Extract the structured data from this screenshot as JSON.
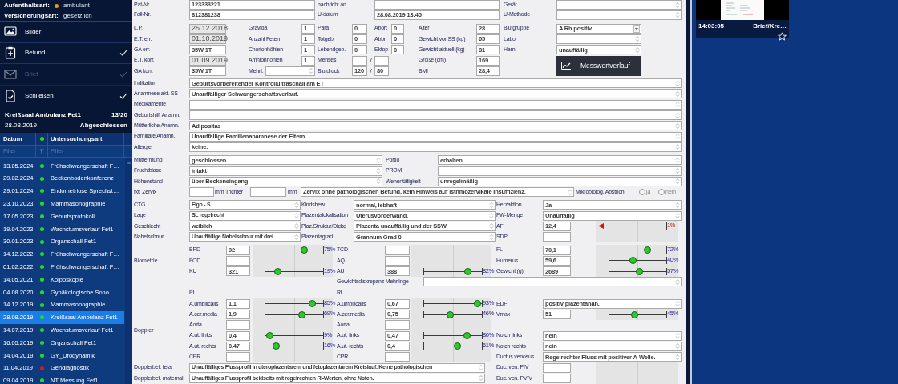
{
  "sidebar": {
    "info": [
      {
        "label": "Aufenthaltsart:",
        "value": "ambulant",
        "color": "#e0a010"
      },
      {
        "label": "Versicherungsart:",
        "value": "gesetzlich"
      }
    ],
    "actions": [
      {
        "kind": "images",
        "label": "Bilder",
        "checked": false,
        "disabled": false
      },
      {
        "kind": "report",
        "label": "Befund",
        "checked": true,
        "disabled": false
      },
      {
        "kind": "letter",
        "label": "Brief",
        "checked": true,
        "disabled": true
      },
      {
        "kind": "close",
        "label": "Schließen",
        "checked": true,
        "disabled": false
      }
    ],
    "exam": {
      "title": "Kreißsaal Ambulanz Fet1",
      "count": "13/20",
      "date": "28.08.2019",
      "status": "Abgeschlossen"
    },
    "table": {
      "columns": [
        "Datum",
        "Untersuchungsart"
      ],
      "filters": [
        "Filter",
        "Filter"
      ],
      "rows": [
        {
          "date": "13.05.2024",
          "type": "Frühschwangerschaft F…",
          "color": "#22dd22",
          "selected": false
        },
        {
          "date": "29.02.2024",
          "type": "Beckenbodenkonferenz",
          "color": "#22dd22",
          "selected": false
        },
        {
          "date": "29.01.2024",
          "type": "Endometriose Sprechst…",
          "color": "#22dd22",
          "selected": false
        },
        {
          "date": "23.10.2023",
          "type": "Mammasonographie",
          "color": "#22dd22",
          "selected": false
        },
        {
          "date": "17.05.2023",
          "type": "Geburtsprotokoll",
          "color": "#22dd22",
          "selected": false
        },
        {
          "date": "19.04.2023",
          "type": "Wachstumsverlauf Fet1",
          "color": "#22dd22",
          "selected": false
        },
        {
          "date": "30.01.2023",
          "type": "Organschall Fet1",
          "color": "#22dd22",
          "selected": false
        },
        {
          "date": "14.12.2022",
          "type": "Frühschwangerschaft F…",
          "color": "#22dd22",
          "selected": false
        },
        {
          "date": "01.02.2022",
          "type": "Frühschwangerschaft F…",
          "color": "#22dd22",
          "selected": false
        },
        {
          "date": "14.05.2021",
          "type": "Kolposkopie",
          "color": "#22dd22",
          "selected": false
        },
        {
          "date": "04.08.2020",
          "type": "Gynäkologische Sono",
          "color": "#22dd22",
          "selected": false
        },
        {
          "date": "14.12.2019",
          "type": "Mammasonographie",
          "color": "#22dd22",
          "selected": false
        },
        {
          "date": "28.08.2019",
          "type": "Kreißsaal Ambulanz Fet1",
          "color": "#22dd22",
          "selected": true
        },
        {
          "date": "14.07.2019",
          "type": "Wachstumsverlauf Fet1",
          "color": "#22dd22",
          "selected": false
        },
        {
          "date": "16.05.2019",
          "type": "Organschall Fet1",
          "color": "#22dd22",
          "selected": false
        },
        {
          "date": "14.04.2019",
          "type": "GY_Urodynamik",
          "color": "#22dd22",
          "selected": false
        },
        {
          "date": "11.04.2019",
          "type": "Gendiagnostik",
          "color": "#ee1111",
          "selected": false
        },
        {
          "date": "09.04.2019",
          "type": "NT Messung Fet1",
          "color": "#22dd22",
          "selected": false
        }
      ]
    }
  },
  "form": {
    "top_rows": [
      [
        {
          "label": "Pat-Nr.",
          "value": "123333221"
        },
        {
          "label": "nachricht.an"
        },
        {
          "label": "Gerät"
        }
      ],
      [
        {
          "label": "Fall-Nr.",
          "value": "812381238"
        },
        {
          "label": "U-datum",
          "value": "28.08.2019 13:45"
        },
        {
          "label": "U-Methode"
        }
      ]
    ],
    "history": [
      {
        "kind": "date",
        "label": "L.P.",
        "value": "25.12.2018"
      },
      {
        "kind": "date",
        "label": "E.T. err.",
        "value": "01.10.2019"
      },
      {
        "kind": "text",
        "label": "GA err.",
        "value": "35W 1T"
      },
      {
        "kind": "date",
        "label": "E.T. korr.",
        "value": "01.09.2019"
      },
      {
        "kind": "text",
        "label": "GA korr.",
        "value": "35W 1T"
      }
    ],
    "counts": [
      {
        "kind": "number",
        "label": "Gravida",
        "value": "1"
      },
      {
        "kind": "number",
        "label": "Anzahl Feten",
        "value": "1"
      },
      {
        "kind": "number",
        "label": "Chorionhöhlen",
        "value": "1"
      },
      {
        "kind": "number",
        "label": "Amnionhöhlen",
        "value": "1"
      },
      {
        "kind": "spin",
        "label": "Mehrl."
      }
    ],
    "births": [
      {
        "kind": "number",
        "label": "Para",
        "value": "0"
      },
      {
        "kind": "number",
        "label": "Totgeb.",
        "value": "0"
      },
      {
        "kind": "number",
        "label": "Lebendgeb.",
        "value": "0"
      },
      {
        "kind": "pair",
        "label": "Menses",
        "separator": "/"
      },
      {
        "kind": "pair",
        "label": "Blutdruck",
        "value": "120",
        "separator": "/",
        "value2": "80"
      }
    ],
    "losses": [
      {
        "label": "Abort",
        "value": "0"
      },
      {
        "label": "Abbr.",
        "value": "0"
      },
      {
        "label": "Ektop",
        "value": "0"
      }
    ],
    "vitals": [
      {
        "label": "Alter",
        "value": "28"
      },
      {
        "label": "Gewicht vor SS (kg)",
        "value": "65"
      },
      {
        "label": "Gewicht aktuell (kg)",
        "value": "81"
      },
      {
        "label": "Größe (cm)",
        "value": "169"
      },
      {
        "label": "BMI",
        "value": "28,4"
      }
    ],
    "lab": [
      {
        "kind": "select",
        "label": "Blutgruppe",
        "value": "A Rh positiv"
      },
      {
        "kind": "memo",
        "label": "Labor"
      },
      {
        "kind": "memo",
        "label": "Harn",
        "value": "unauffällig"
      }
    ],
    "chart_button": "Messwertverlauf",
    "notes": [
      {
        "label": "Indikation",
        "value": "Geburtsvorbereitender Kontrollultraschall am ET"
      },
      {
        "label": "Anamnese akt. SS",
        "value": "Unauffälliger Schwangerschaftsverlauf."
      },
      {
        "label": "Medikamente"
      },
      {
        "label": "Geburtshilf. Anamn."
      },
      {
        "label": "Mütterliche Anamn.",
        "value": "Adipositas"
      },
      {
        "label": "Familiäre Anamn.",
        "value": "Unauffällige Familienanamnese der Eltern."
      },
      {
        "label": "Allergie",
        "value": "keine."
      }
    ],
    "cervix": [
      [
        {
          "label": "Muttermund",
          "value": "geschlossen"
        },
        {
          "label": "Portio",
          "value": "erhalten"
        }
      ],
      [
        {
          "label": "Fruchtblase",
          "value": "intakt"
        },
        {
          "label": "PROM"
        }
      ],
      [
        {
          "label": "Höhenstand",
          "value": "über Beckeneingang"
        },
        {
          "label": "Wehentätigkeit",
          "value": "unregelmäßig"
        }
      ]
    ],
    "zervix": {
      "label": "fkt. Zervix",
      "unit": "mm",
      "funnel_label": "Trichter",
      "funnel_unit": "mm",
      "finding": "Zervix ohne pathologischen Befund, kein Hinweis auf isthmozervikale Insuffizienz.",
      "swab_label": "Mikrobiolog. Abstrich",
      "options": [
        {
          "label": "ja",
          "selected": false
        },
        {
          "label": "nein",
          "selected": false
        }
      ]
    },
    "obstetric": [
      [
        {
          "label": "CTG",
          "value": "Figo - S"
        },
        {
          "label": "Kindsbew.",
          "value": "normal, lebhaft"
        },
        {
          "kind": "memo",
          "label": "Herzaktion",
          "value": "Ja"
        }
      ],
      [
        {
          "label": "Lage",
          "value": "SL regelrecht"
        },
        {
          "label": "Plazentalokalisation",
          "value": "Uterusvorderwand."
        },
        {
          "kind": "memo",
          "label": "FW-Menge",
          "value": "Unauffällig"
        }
      ],
      [
        {
          "label": "Geschlecht",
          "value": "weiblich"
        },
        {
          "label": "Plaz.Struktur/Dicke",
          "value": "Plazenta unauffällig und der SSW"
        },
        {
          "kind": "measure",
          "label": "AFI",
          "value": "12,4",
          "below_range": true,
          "reading": "1%"
        }
      ],
      [
        {
          "label": "Nabelschnur",
          "value": "Unauffällige Nabelschnur mit drei"
        },
        {
          "label": "Plazentagrad",
          "value": "Grannum Grad 0"
        },
        {
          "kind": "measure",
          "label": "SDP"
        }
      ]
    ],
    "biometry": {
      "label": "Biometrie",
      "rows": [
        [
          {
            "label": "BPD",
            "value": "92",
            "level": 0.68,
            "reading": "75%"
          },
          {
            "label": "TCD"
          },
          {
            "kind": "measure",
            "label": "FL",
            "value": "70,1",
            "level": 0.67,
            "reading": "72%"
          }
        ],
        [
          {
            "label": "FOD"
          },
          {
            "label": "AQ"
          },
          {
            "kind": "measure",
            "label": "Humerus",
            "value": "59,6",
            "level": 0.41,
            "reading": "40%"
          }
        ],
        [
          {
            "label": "KU",
            "value": "321",
            "level": 0.22,
            "reading": "19%"
          },
          {
            "label": "AU",
            "value": "388",
            "level": 0.76,
            "reading": "82%"
          },
          {
            "kind": "measure",
            "label": "Gewicht (g)",
            "value": "2689",
            "level": 0.53,
            "reading": "57%"
          }
        ]
      ]
    },
    "discrepancy": {
      "label": "Gewichtsdiskrepanz Mehrlinge"
    },
    "doppler": {
      "label": "Doppler",
      "headings": [
        "PI",
        "RI"
      ],
      "rows": [
        [
          {
            "label": "A.umbilicalis",
            "value": "1,1",
            "level": 0.81,
            "reading": "85%"
          },
          {
            "label": "A.umbilicalis",
            "value": "0,67",
            "level": 0.93,
            "reading": "93%"
          },
          {
            "kind": "memo",
            "label": "EDF",
            "value": "positiv plazentanah."
          }
        ],
        [
          {
            "label": "A.cer.media",
            "value": "1,9",
            "level": 0.63,
            "reading": "69%"
          },
          {
            "label": "A.cer.media",
            "value": "0,75",
            "level": 0.45,
            "reading": "46%"
          },
          {
            "kind": "measure",
            "label": "Vmax",
            "value": "51",
            "level": 0.45,
            "reading": "45%"
          }
        ],
        [
          {
            "label": "Aorta"
          },
          {
            "label": "Aorta"
          }
        ],
        [
          {
            "label": "A.ut. links",
            "value": "0,4",
            "level": 0.08,
            "reading": "9%"
          },
          {
            "label": "A.ut. links",
            "value": "0,47",
            "level": 0.74,
            "reading": "80%"
          },
          {
            "kind": "memo",
            "label": "Notch links",
            "value": "nein"
          }
        ],
        [
          {
            "label": "A.ut. rechts",
            "value": "0,47",
            "level": 0.19,
            "reading": "16%"
          },
          {
            "label": "A.ut. rechts",
            "value": "0,4",
            "level": 0.57,
            "reading": "61%"
          },
          {
            "kind": "memo",
            "label": "Notch rechts",
            "value": "nein"
          }
        ],
        [
          {
            "label": "CPR"
          },
          {
            "label": "CPR"
          },
          {
            "kind": "memo",
            "label": "Ductus venosus",
            "value": "Regelrechter Fluss mit positiver A-Welle."
          }
        ]
      ]
    },
    "doppler_findings": [
      {
        "label": "Dopplerbef. fetal",
        "value": "Unauffälliges Flussprofil in uteroplazentarem und fetoplazentarem Kreislauf. Keine pathologischen",
        "side": {
          "label": "Duc. ven. PIV"
        }
      },
      {
        "label": "Dopplerbef. maternal",
        "value": "Unauffälliges Flussprofil beidseits mit regelrechten RI-Werten, ohne Notch.",
        "side": {
          "label": "Duc. ven. PVIV"
        }
      }
    ]
  },
  "thumbnail": {
    "time": "14:03:05",
    "title": "Brief/Kre…",
    "starred": false
  }
}
